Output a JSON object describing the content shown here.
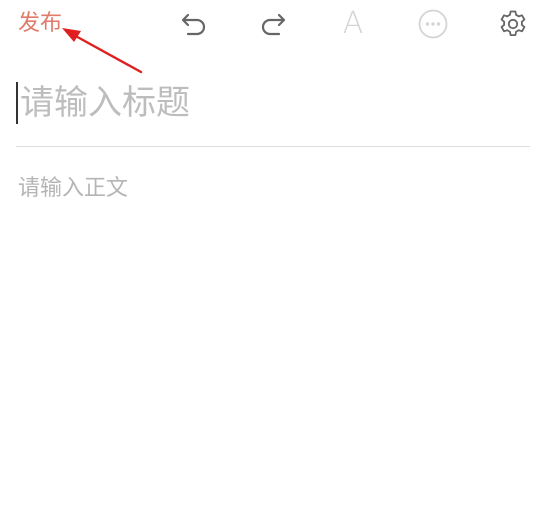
{
  "toolbar": {
    "publish_label": "发布",
    "font_label": "A",
    "icons": {
      "undo": "undo-icon",
      "redo": "redo-icon",
      "font": "font-format-icon",
      "more": "more-options-icon",
      "settings": "gear-icon"
    }
  },
  "editor": {
    "title_placeholder": "请输入标题",
    "body_placeholder": "请输入正文"
  },
  "colors": {
    "accent": "#e07a6a",
    "icon": "#666666",
    "icon_disabled": "#d4d4d4",
    "annotation_arrow": "#e02020"
  }
}
